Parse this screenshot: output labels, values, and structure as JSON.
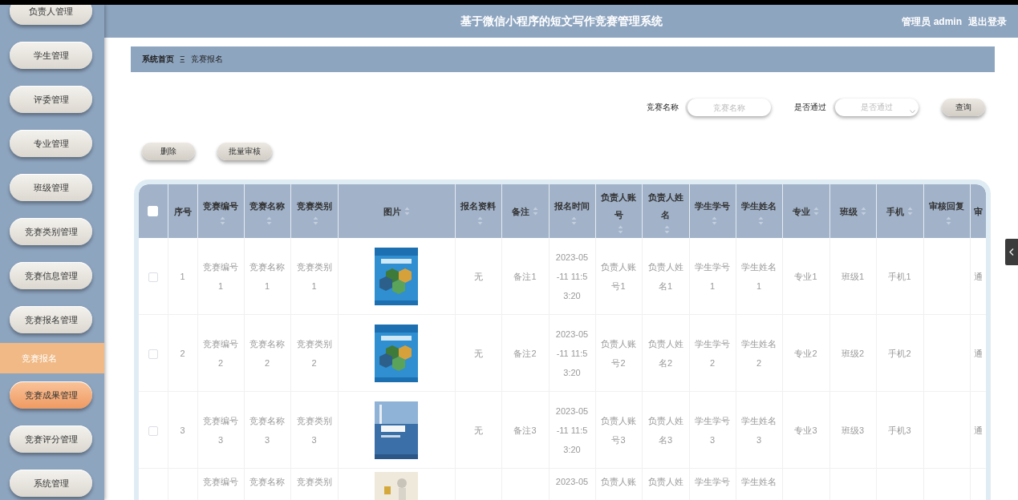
{
  "header": {
    "title": "基于微信小程序的短文写作竞赛管理系统",
    "user": "管理员 admin",
    "logout": "退出登录"
  },
  "sidebar": {
    "items": [
      {
        "label": "负责人管理",
        "kind": "group",
        "selected": false,
        "highlighted": false
      },
      {
        "label": "学生管理",
        "kind": "group",
        "selected": false,
        "highlighted": false
      },
      {
        "label": "评委管理",
        "kind": "group",
        "selected": false,
        "highlighted": false
      },
      {
        "label": "专业管理",
        "kind": "group",
        "selected": false,
        "highlighted": false
      },
      {
        "label": "班级管理",
        "kind": "group",
        "selected": false,
        "highlighted": false
      },
      {
        "label": "竞赛类别管理",
        "kind": "group",
        "selected": false,
        "highlighted": false
      },
      {
        "label": "竞赛信息管理",
        "kind": "group",
        "selected": false,
        "highlighted": false
      },
      {
        "label": "竞赛报名管理",
        "kind": "group",
        "selected": false,
        "highlighted": false
      },
      {
        "label": "竞赛报名",
        "kind": "item",
        "selected": true,
        "highlighted": false
      },
      {
        "label": "竞赛成果管理",
        "kind": "group",
        "selected": false,
        "highlighted": true
      },
      {
        "label": "竞赛评分管理",
        "kind": "group",
        "selected": false,
        "highlighted": false
      },
      {
        "label": "系统管理",
        "kind": "group",
        "selected": false,
        "highlighted": false
      }
    ]
  },
  "breadcrumb": {
    "home": "系统首页",
    "separator": "Ξ",
    "current": "竞赛报名"
  },
  "search": {
    "fields": [
      {
        "label": "竞赛名称",
        "kind": "input",
        "placeholder": "竞赛名称"
      },
      {
        "label": "是否通过",
        "kind": "select",
        "placeholder": "是否通过"
      }
    ],
    "button": "查询"
  },
  "actions": [
    "删除",
    "批量审核"
  ],
  "table": {
    "columns": [
      {
        "kind": "checkbox",
        "checked": false
      },
      {
        "label": "序号",
        "kind": "text",
        "sortable": false
      },
      {
        "label": "竞赛编号",
        "kind": "text",
        "sortable": true
      },
      {
        "label": "竞赛名称",
        "kind": "text",
        "sortable": true
      },
      {
        "label": "竞赛类别",
        "kind": "text",
        "sortable": true
      },
      {
        "label": "图片",
        "kind": "text",
        "sortable": true
      },
      {
        "label": "报名资料",
        "kind": "text",
        "sortable": true
      },
      {
        "label": "备注",
        "kind": "text",
        "sortable": true
      },
      {
        "label": "报名时间",
        "kind": "text",
        "sortable": true
      },
      {
        "label": "负责人账号",
        "kind": "text",
        "sortable": true
      },
      {
        "label": "负责人姓名",
        "kind": "text",
        "sortable": true
      },
      {
        "label": "学生学号",
        "kind": "text",
        "sortable": true
      },
      {
        "label": "学生姓名",
        "kind": "text",
        "sortable": true
      },
      {
        "label": "专业",
        "kind": "text",
        "sortable": true
      },
      {
        "label": "班级",
        "kind": "text",
        "sortable": true
      },
      {
        "label": "手机",
        "kind": "text",
        "sortable": true
      },
      {
        "label": "审核回复",
        "kind": "text",
        "sortable": true
      },
      {
        "label": "审",
        "kind": "text",
        "sortable": false
      }
    ],
    "rows": [
      {
        "cells": [
          {
            "kind": "checkbox",
            "checked": false
          },
          {
            "kind": "text",
            "text": "1"
          },
          {
            "kind": "text",
            "text": "竞赛编号1"
          },
          {
            "kind": "text",
            "text": "竞赛名称1"
          },
          {
            "kind": "text",
            "text": "竞赛类别1"
          },
          {
            "kind": "picture"
          },
          {
            "kind": "text",
            "text": "无"
          },
          {
            "kind": "text",
            "text": "备注1"
          },
          {
            "kind": "text",
            "text": "2023-05-11 11:53:20"
          },
          {
            "kind": "text",
            "text": "负责人账号1"
          },
          {
            "kind": "text",
            "text": "负责人姓名1"
          },
          {
            "kind": "text",
            "text": "学生学号1"
          },
          {
            "kind": "text",
            "text": "学生姓名1"
          },
          {
            "kind": "text",
            "text": "专业1"
          },
          {
            "kind": "text",
            "text": "班级1"
          },
          {
            "kind": "text",
            "text": "手机1"
          },
          {
            "kind": "empty"
          },
          {
            "kind": "text",
            "text": "通"
          }
        ]
      },
      {
        "cells": [
          {
            "kind": "checkbox",
            "checked": false
          },
          {
            "kind": "text",
            "text": "2"
          },
          {
            "kind": "text",
            "text": "竞赛编号2"
          },
          {
            "kind": "text",
            "text": "竞赛名称2"
          },
          {
            "kind": "text",
            "text": "竞赛类别2"
          },
          {
            "kind": "picture"
          },
          {
            "kind": "text",
            "text": "无"
          },
          {
            "kind": "text",
            "text": "备注2"
          },
          {
            "kind": "text",
            "text": "2023-05-11 11:53:20"
          },
          {
            "kind": "text",
            "text": "负责人账号2"
          },
          {
            "kind": "text",
            "text": "负责人姓名2"
          },
          {
            "kind": "text",
            "text": "学生学号2"
          },
          {
            "kind": "text",
            "text": "学生姓名2"
          },
          {
            "kind": "text",
            "text": "专业2"
          },
          {
            "kind": "text",
            "text": "班级2"
          },
          {
            "kind": "text",
            "text": "手机2"
          },
          {
            "kind": "empty"
          },
          {
            "kind": "text",
            "text": "通"
          }
        ]
      },
      {
        "cells": [
          {
            "kind": "checkbox",
            "checked": false
          },
          {
            "kind": "text",
            "text": "3"
          },
          {
            "kind": "text",
            "text": "竞赛编号3"
          },
          {
            "kind": "text",
            "text": "竞赛名称3"
          },
          {
            "kind": "text",
            "text": "竞赛类别3"
          },
          {
            "kind": "picture"
          },
          {
            "kind": "text",
            "text": "无"
          },
          {
            "kind": "text",
            "text": "备注3"
          },
          {
            "kind": "text",
            "text": "2023-05-11 11:53:20"
          },
          {
            "kind": "text",
            "text": "负责人账号3"
          },
          {
            "kind": "text",
            "text": "负责人姓名3"
          },
          {
            "kind": "text",
            "text": "学生学号3"
          },
          {
            "kind": "text",
            "text": "学生姓名3"
          },
          {
            "kind": "text",
            "text": "专业3"
          },
          {
            "kind": "text",
            "text": "班级3"
          },
          {
            "kind": "text",
            "text": "手机3"
          },
          {
            "kind": "empty"
          },
          {
            "kind": "text",
            "text": "通"
          }
        ]
      },
      {
        "cells": [
          {
            "kind": "empty"
          },
          {
            "kind": "empty"
          },
          {
            "kind": "text",
            "text": "竞赛编号"
          },
          {
            "kind": "text",
            "text": "竞赛名称"
          },
          {
            "kind": "text",
            "text": "竞赛类别"
          },
          {
            "kind": "picture"
          },
          {
            "kind": "empty"
          },
          {
            "kind": "empty"
          },
          {
            "kind": "text",
            "text": "2023-05"
          },
          {
            "kind": "text",
            "text": "负责人账"
          },
          {
            "kind": "text",
            "text": "负责人姓"
          },
          {
            "kind": "text",
            "text": "学生学号"
          },
          {
            "kind": "text",
            "text": "学生姓名"
          },
          {
            "kind": "empty"
          },
          {
            "kind": "empty"
          },
          {
            "kind": "empty"
          },
          {
            "kind": "empty"
          },
          {
            "kind": "empty"
          }
        ]
      }
    ]
  }
}
